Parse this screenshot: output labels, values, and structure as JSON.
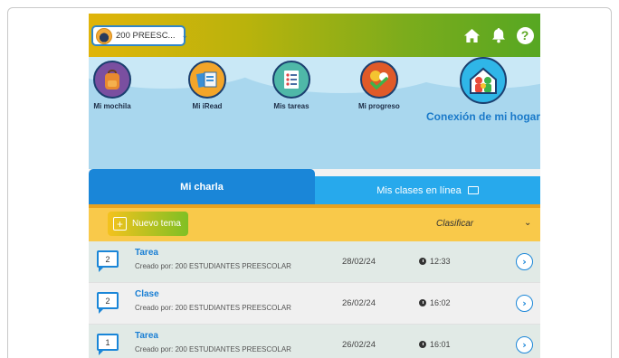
{
  "header": {
    "class_selector": "200 PREESC...",
    "icons": [
      "home-icon",
      "bell-icon",
      "help-icon"
    ],
    "help_glyph": "?"
  },
  "nav": {
    "items": [
      {
        "label": "Mi mochila",
        "icon": "backpack-icon"
      },
      {
        "label": "Mi iRead",
        "icon": "iread-icon"
      },
      {
        "label": "Mis tareas",
        "icon": "tasks-icon"
      },
      {
        "label": "Mi progreso",
        "icon": "progress-icon"
      }
    ],
    "home_connection": {
      "label": "Conexión de mi hogar",
      "icon": "family-house-icon"
    }
  },
  "tabs": {
    "charla": "Mi charla",
    "online": "Mis clases en línea"
  },
  "toolbar": {
    "new_topic": "Nuevo tema",
    "sort": "Clasificar"
  },
  "posts": [
    {
      "count": "2",
      "title": "Tarea",
      "subtitle": "Creado por: 200 ESTUDIANTES PREESCOLAR",
      "date": "28/02/24",
      "time": "12:33"
    },
    {
      "count": "2",
      "title": "Clase",
      "subtitle": "Creado por: 200 ESTUDIANTES PREESCOLAR",
      "date": "26/02/24",
      "time": "16:02"
    },
    {
      "count": "1",
      "title": "Tarea",
      "subtitle": "Creado por: 200 ESTUDIANTES PREESCOLAR",
      "date": "26/02/24",
      "time": "16:01"
    }
  ],
  "colors": {
    "primary_blue": "#1a86d8",
    "tab_light_blue": "#27a9ec",
    "toolbar_yellow": "#f9c94a",
    "header_gold": "#e0b40a",
    "header_green": "#56a722"
  }
}
